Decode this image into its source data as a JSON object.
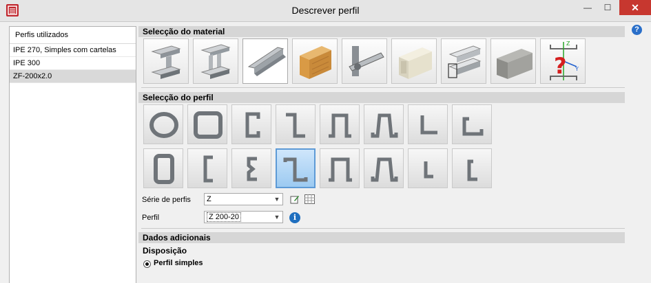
{
  "window": {
    "title": "Descrever perfil",
    "minimize_glyph": "—",
    "maximize_glyph": "☐",
    "close_glyph": "✕"
  },
  "profiles_panel": {
    "header": "Perfis utilizados",
    "items": [
      {
        "label": "IPE 270, Simples com cartelas",
        "selected": false
      },
      {
        "label": "IPE 300",
        "selected": false
      },
      {
        "label": "ZF-200x2.0",
        "selected": true
      }
    ]
  },
  "material_section": {
    "title": "Selecção do material",
    "buttons": [
      {
        "icon": "hot-rolled-steel-i-beam-icon",
        "selected": false
      },
      {
        "icon": "built-up-steel-beam-icon",
        "selected": false
      },
      {
        "icon": "cold-formed-steel-z-profile-icon",
        "selected": true
      },
      {
        "icon": "wood-beam-icon",
        "selected": false
      },
      {
        "icon": "aluminium-profile-icon",
        "selected": false
      },
      {
        "icon": "concrete-box-section-icon",
        "selected": false
      },
      {
        "icon": "aluminium-extrusion-icon",
        "selected": false
      },
      {
        "icon": "masonry-block-icon",
        "selected": false
      },
      {
        "icon": "generic-section-axes-icon",
        "selected": false
      }
    ]
  },
  "profile_section": {
    "title": "Selecção do perfil",
    "shapes": [
      {
        "icon": "circular-tube-profile-icon",
        "selected": false
      },
      {
        "icon": "square-tube-profile-icon",
        "selected": false
      },
      {
        "icon": "c-lipped-profile-icon",
        "selected": false
      },
      {
        "icon": "z-profile-icon",
        "selected": false
      },
      {
        "icon": "omega-profile-icon",
        "selected": false
      },
      {
        "icon": "omega-lipped-profile-icon",
        "selected": false
      },
      {
        "icon": "angle-profile-icon",
        "selected": false
      },
      {
        "icon": "angle-lipped-profile-icon",
        "selected": false
      },
      {
        "icon": "rectangular-tube-profile-icon",
        "selected": false
      },
      {
        "icon": "c-channel-profile-icon",
        "selected": false
      },
      {
        "icon": "sigma-profile-icon",
        "selected": false
      },
      {
        "icon": "z-lipped-profile-icon",
        "selected": true
      },
      {
        "icon": "omega-wide-profile-icon",
        "selected": false
      },
      {
        "icon": "omega-wide-lipped-profile-icon",
        "selected": false
      },
      {
        "icon": "angle-small-profile-icon",
        "selected": false
      },
      {
        "icon": "c-small-lipped-profile-icon",
        "selected": false
      }
    ]
  },
  "series": {
    "label": "Série de perfis",
    "value": "Z"
  },
  "profile": {
    "label": "Perfil",
    "value": "Z 200-20"
  },
  "additional": {
    "title": "Dados adicionais",
    "disposition_label": "Disposição",
    "option_label": "Perfil simples",
    "option_checked": true
  },
  "help_glyph": "?",
  "info_glyph": "i",
  "colors": {
    "close_button": "#c7372f",
    "selected_shape": "#9ccaf1",
    "info_icon": "#1f6fbf"
  }
}
